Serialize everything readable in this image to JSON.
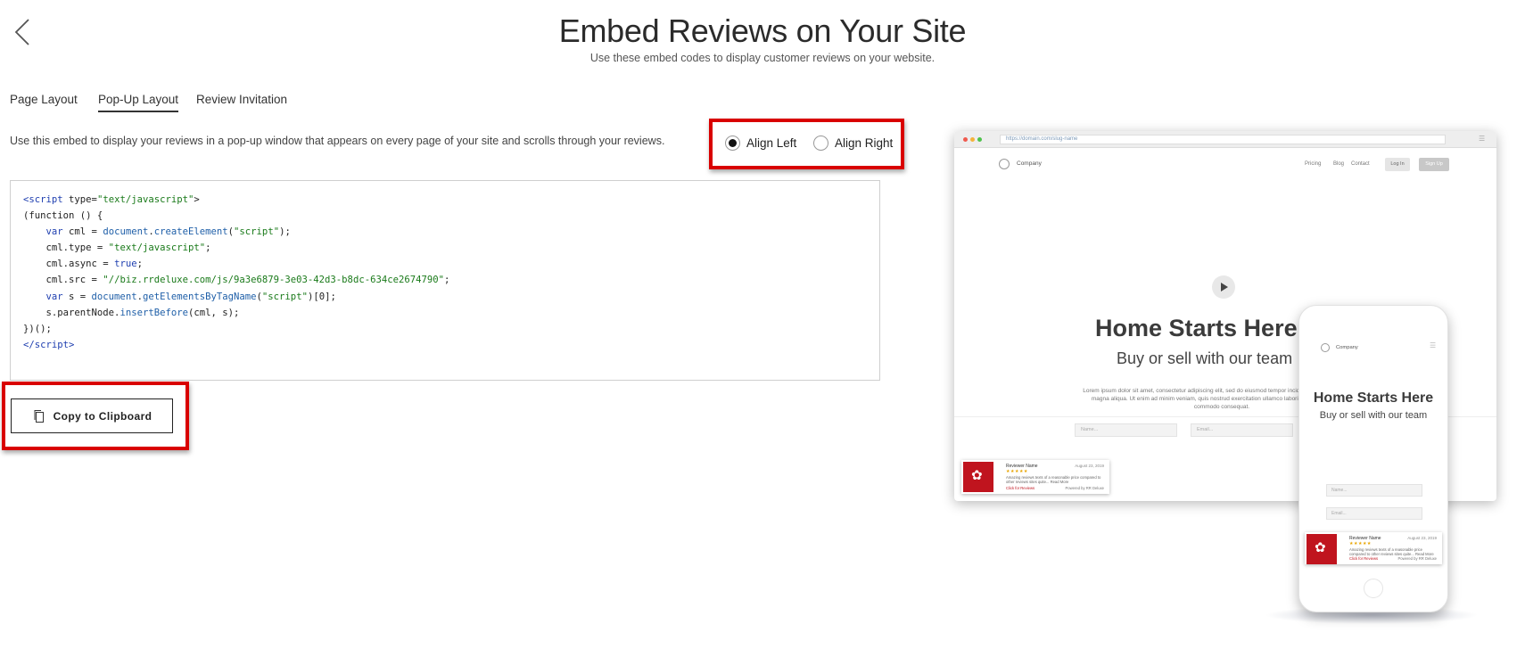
{
  "header": {
    "title": "Embed Reviews on Your Site",
    "subtitle": "Use these embed codes to display customer reviews on your website."
  },
  "tabs": [
    {
      "label": "Page Layout",
      "active": false
    },
    {
      "label": "Pop-Up Layout",
      "active": true
    },
    {
      "label": "Review Invitation",
      "active": false
    }
  ],
  "description": "Use this embed to display your reviews in a pop-up window that appears on every page of your site and scrolls through your reviews.",
  "alignment": {
    "selected": "left",
    "options": [
      {
        "label": "Align Left",
        "selected": true
      },
      {
        "label": "Align Right",
        "selected": false
      }
    ]
  },
  "embed_code": {
    "script_type": "text/javascript",
    "src": "//biz.rrdeluxe.com/js/9a3e6879-3e03-42d3-b8dc-634ce2674790"
  },
  "copy_button": {
    "label": "Copy to Clipboard"
  },
  "accent_color": "#d90000",
  "preview": {
    "url": "https://domain.com/slug-name",
    "company": "Company",
    "nav": [
      "Pricing",
      "Blog",
      "Contact"
    ],
    "login": "Log In",
    "signup": "Sign Up",
    "hero_title": "Home Starts Here",
    "hero_subtitle": "Buy or sell with our team",
    "lorem": "Lorem ipsum dolor sit amet, consectetur adipiscing elit, sed do eiusmod tempor incididunt ut labore et dolore magna aliqua. Ut enim ad minim veniam, quis nostrud exercitation ullamco laboris nisi ut aliquip ex ea commodo consequat.",
    "name_placeholder": "Name...",
    "email_placeholder": "Email...",
    "review": {
      "reviewer": "Reviewer Name",
      "date": "August 23, 2019",
      "stars": "★★★★★",
      "text": "Amazing reviews texts of a reasonable price compared to other reviews sites quite... Read More",
      "link": "Click for Reviews",
      "powered": "Powered by RR Deluxe"
    }
  }
}
